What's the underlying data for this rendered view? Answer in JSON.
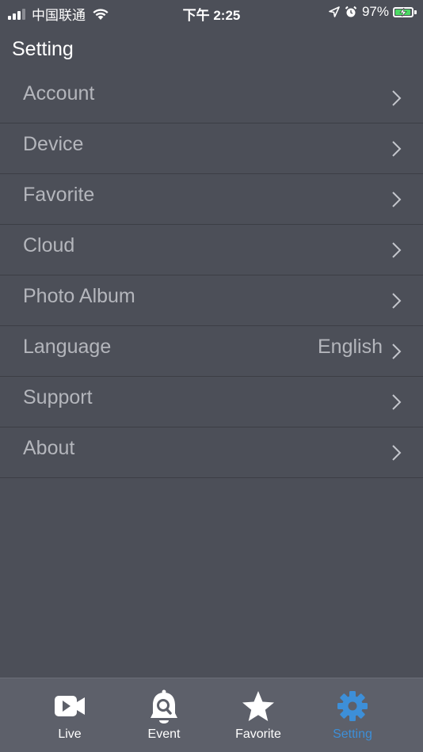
{
  "status_bar": {
    "carrier": "中国联通",
    "time": "下午 2:25",
    "battery_percent": "97%",
    "battery_level": 0.97,
    "signal_bars": 3,
    "icons": [
      "signal-icon",
      "wifi-icon",
      "location-icon",
      "alarm-icon",
      "battery-icon"
    ]
  },
  "header": {
    "title": "Setting"
  },
  "settings": {
    "items": [
      {
        "label": "Account",
        "value": ""
      },
      {
        "label": "Device",
        "value": ""
      },
      {
        "label": "Favorite",
        "value": ""
      },
      {
        "label": "Cloud",
        "value": ""
      },
      {
        "label": "Photo Album",
        "value": ""
      },
      {
        "label": "Language",
        "value": "English"
      },
      {
        "label": "Support",
        "value": ""
      },
      {
        "label": "About",
        "value": ""
      }
    ]
  },
  "tab_bar": {
    "active": "Setting",
    "tabs": [
      {
        "label": "Live",
        "icon": "video-camera-icon"
      },
      {
        "label": "Event",
        "icon": "bell-search-icon"
      },
      {
        "label": "Favorite",
        "icon": "star-icon"
      },
      {
        "label": "Setting",
        "icon": "gear-icon"
      }
    ]
  },
  "colors": {
    "background": "#4c4f58",
    "tab_bar_background": "#5d606a",
    "row_text": "#b4b6bc",
    "active_tab": "#3d8fd8",
    "battery_fill": "#4cd964"
  }
}
